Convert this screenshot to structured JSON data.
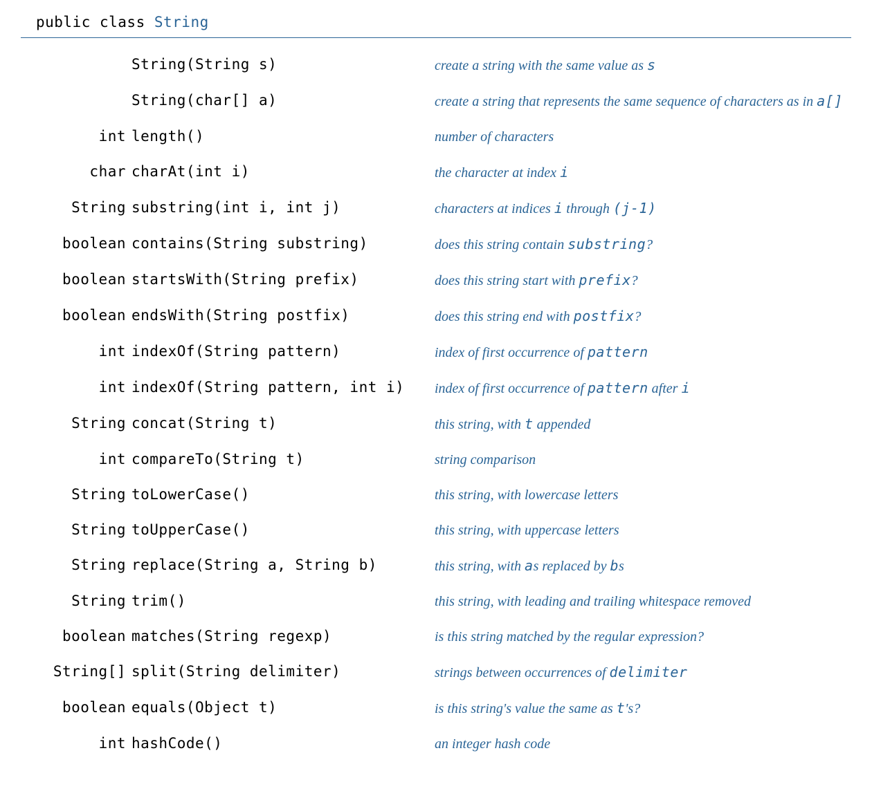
{
  "header": {
    "keyword": "public class ",
    "classname": "String"
  },
  "rows": [
    {
      "ret": "",
      "sig": "String(String s)",
      "desc": "create a string with the same value as <c>s</c>"
    },
    {
      "ret": "",
      "sig": "String(char[] a)",
      "desc": "create a string that represents the same sequence of characters as in <c>a[]</c>"
    },
    {
      "ret": "int",
      "sig": "length()",
      "desc": "number of characters"
    },
    {
      "ret": "char",
      "sig": "charAt(int i)",
      "desc": "the character at index <c>i</c>"
    },
    {
      "ret": "String",
      "sig": "substring(int i, int j)",
      "desc": "characters at indices <c>i</c> through <c>(j-1)</c>"
    },
    {
      "ret": "boolean",
      "sig": "contains(String substring)",
      "desc": "does this string contain <c>substring</c>?"
    },
    {
      "ret": "boolean",
      "sig": "startsWith(String prefix)",
      "desc": "does this string start with <c>prefix</c>?"
    },
    {
      "ret": "boolean",
      "sig": "endsWith(String postfix)",
      "desc": "does this string end with <c>postfix</c>?"
    },
    {
      "ret": "int",
      "sig": "indexOf(String pattern)",
      "desc": "index of first occurrence of <c>pattern</c>"
    },
    {
      "ret": "int",
      "sig": "indexOf(String pattern, int i)",
      "desc": "index of first occurrence of <c>pattern</c> after <c>i</c>"
    },
    {
      "ret": "String",
      "sig": "concat(String t)",
      "desc": "this string, with <c>t</c> appended"
    },
    {
      "ret": "int",
      "sig": "compareTo(String t)",
      "desc": "string comparison"
    },
    {
      "ret": "String",
      "sig": "toLowerCase()",
      "desc": "this string, with lowercase letters"
    },
    {
      "ret": "String",
      "sig": "toUpperCase()",
      "desc": "this string, with uppercase letters"
    },
    {
      "ret": "String",
      "sig": "replace(String a, String b)",
      "desc": "this string, with <c>a</c>s replaced by <c>b</c>s"
    },
    {
      "ret": "String",
      "sig": "trim()",
      "desc": "this string, with leading and trailing whitespace removed"
    },
    {
      "ret": "boolean",
      "sig": "matches(String regexp)",
      "desc": "is this string matched by the regular expression?"
    },
    {
      "ret": "String[]",
      "sig": "split(String delimiter)",
      "desc": "strings between occurrences of <c>delimiter</c>"
    },
    {
      "ret": "boolean",
      "sig": "equals(Object t)",
      "desc": "is this string's value the same as <c>t</c>'s?"
    },
    {
      "ret": "int",
      "sig": "hashCode()",
      "desc": "an integer hash code"
    }
  ]
}
